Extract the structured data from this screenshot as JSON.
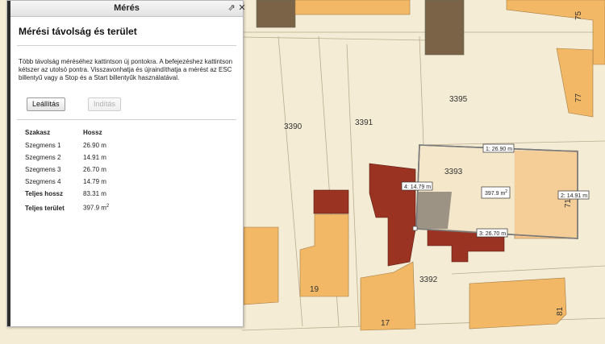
{
  "panel": {
    "title": "Mérés",
    "heading": "Mérési távolság és terület",
    "instructions": "Több távolság méréséhez kattintson új pontokra. A befejezéshez kattintson kétszer az utolsó pontra. Visszavonhatja és újraindíthatja a mérést az ESC billentyű vagy a Stop és a Start billentyűk használatával.",
    "buttons": {
      "stop": "Leállítás",
      "start": "Indítás"
    },
    "header_icons": [
      "collapse-icon",
      "close-icon"
    ],
    "table": {
      "col_segment": "Szakasz",
      "col_length": "Hossz",
      "rows": [
        {
          "name": "Szegmens 1",
          "value": "26.90 m"
        },
        {
          "name": "Szegmens 2",
          "value": "14.91 m"
        },
        {
          "name": "Szegmens 3",
          "value": "26.70 m"
        },
        {
          "name": "Szegmens 4",
          "value": "14.79 m"
        }
      ],
      "total_length_label": "Teljes hossz",
      "total_length_value": "83.31 m",
      "total_area_label": "Teljes terület",
      "total_area_value": "397.9 m",
      "area_unit_sup": "2"
    }
  },
  "map": {
    "parcel_labels": [
      "3390",
      "3391",
      "3395",
      "3393",
      "3392",
      "19",
      "17",
      "75",
      "77",
      "81",
      "71"
    ],
    "measurement_labels": {
      "seg1": "1: 26.90 m",
      "seg2": "2: 14.91 m",
      "seg3": "3: 26.70 m",
      "seg4": "4: 14.79 m",
      "area": "397.9 m",
      "area_sup": "2"
    },
    "colors": {
      "background": "#f4ecd4",
      "parcel_orange": "#f2b866",
      "parcel_dark_red": "#9a3322",
      "parcel_brown": "#7a6347",
      "parcel_grey": "#9d9385",
      "measure_fill": "#f3e6c8",
      "measure_stroke": "#7a7a7a"
    }
  }
}
